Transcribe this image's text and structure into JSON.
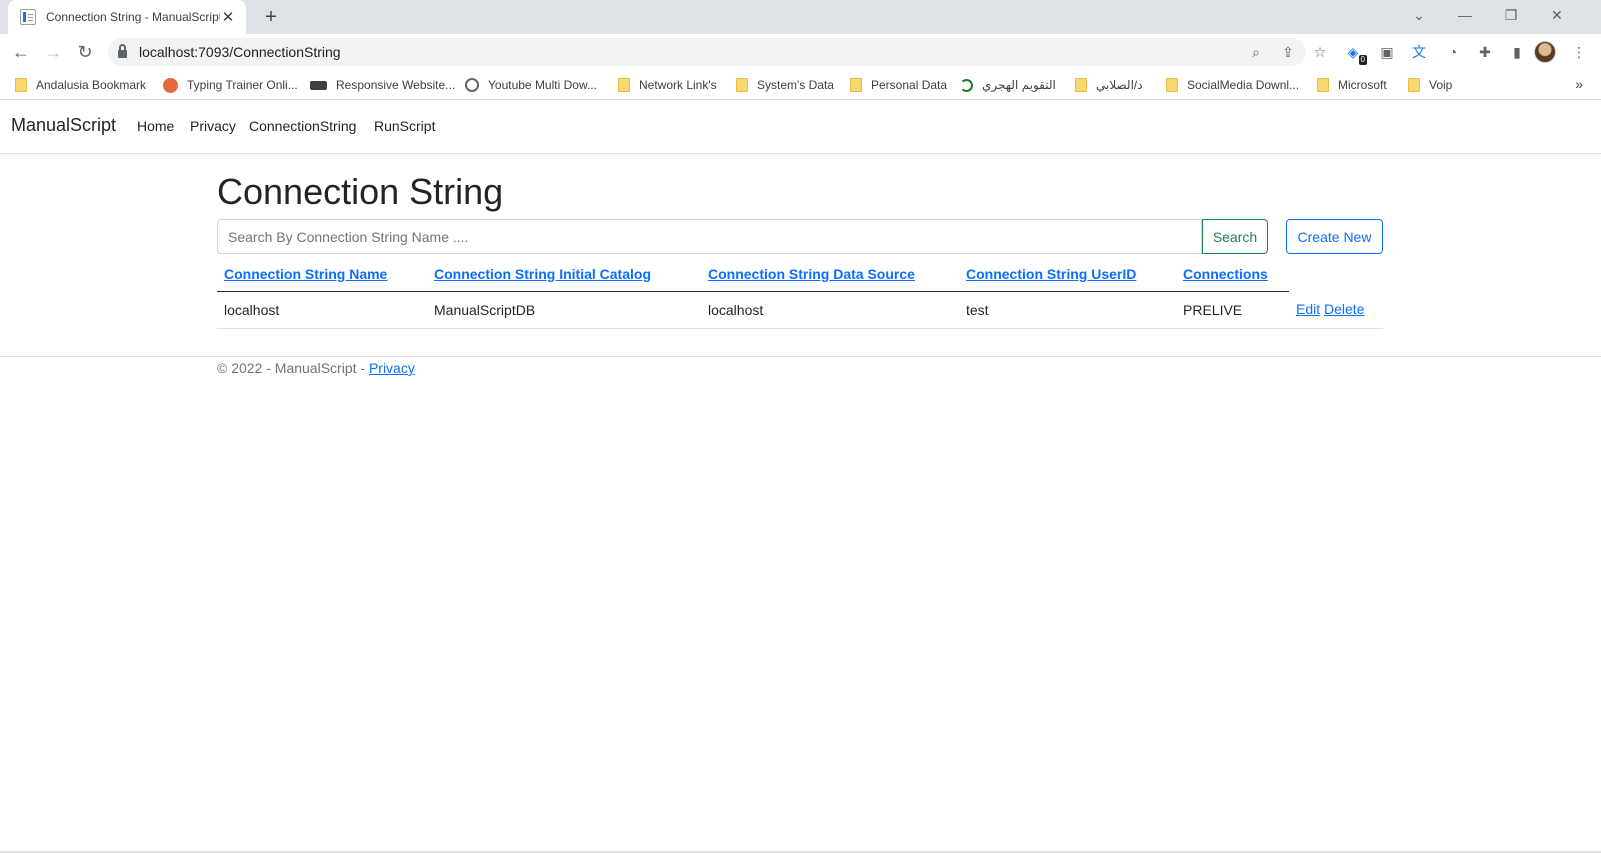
{
  "browser": {
    "tab_title": "Connection String - ManualScript",
    "tab_close": "✕",
    "new_tab": "+",
    "url": "localhost:7093/ConnectionString",
    "extension_badge": "0",
    "bookmarks": [
      {
        "label": "Andalusia Bookmark",
        "icon": "folder-icon"
      },
      {
        "label": "Typing Trainer Onli...",
        "icon": "typing-trainer-icon"
      },
      {
        "label": "Responsive Website...",
        "icon": "website-icon"
      },
      {
        "label": "Youtube Multi Dow...",
        "icon": "globe-icon"
      },
      {
        "label": "Network Link's",
        "icon": "folder-icon"
      },
      {
        "label": "System's Data",
        "icon": "folder-icon"
      },
      {
        "label": "Personal Data",
        "icon": "folder-icon"
      },
      {
        "label": "التقويم الهجري",
        "icon": "crescent-icon"
      },
      {
        "label": "د/الصلابي",
        "icon": "folder-icon"
      },
      {
        "label": "SocialMedia Downl...",
        "icon": "folder-icon"
      },
      {
        "label": "Microsoft",
        "icon": "folder-icon"
      },
      {
        "label": "Voip",
        "icon": "folder-icon"
      }
    ],
    "bookmarks_more": "»"
  },
  "navbar": {
    "brand": "ManualScript",
    "links": [
      "Home",
      "Privacy",
      "ConnectionString",
      "RunScript"
    ]
  },
  "page": {
    "title": "Connection String",
    "search_placeholder": "Search By Connection String Name ....",
    "search_button": "Search",
    "create_button": "Create New"
  },
  "table": {
    "headers": [
      "Connection String Name",
      "Connection String Initial Catalog",
      "Connection String Data Source",
      "Connection String UserID",
      "Connections"
    ],
    "rows": [
      {
        "name": "localhost",
        "catalog": "ManualScriptDB",
        "source": "localhost",
        "userid": "test",
        "connections": "PRELIVE",
        "edit": "Edit",
        "delete": "Delete"
      }
    ]
  },
  "footer": {
    "text": "© 2022 - ManualScript - ",
    "link": "Privacy"
  },
  "colors": {
    "primary": "#0d6efd",
    "success": "#198754",
    "text": "#212529"
  }
}
